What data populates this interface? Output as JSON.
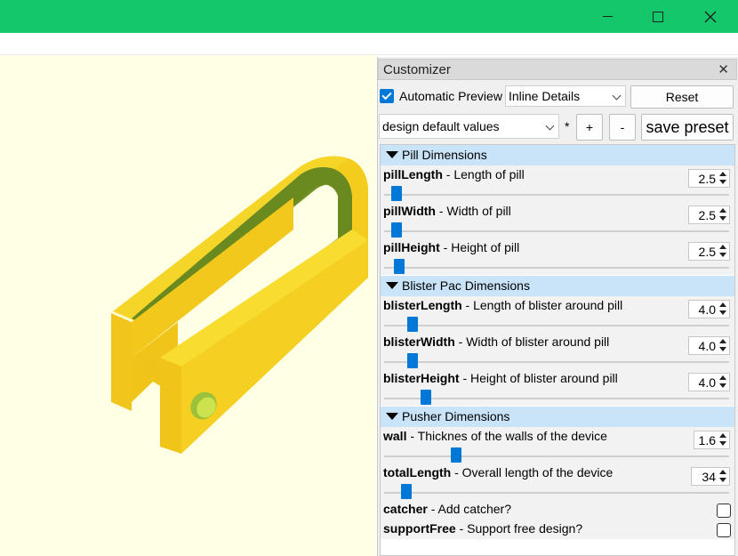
{
  "window": {
    "minimize_icon": "minimize-icon",
    "maximize_icon": "maximize-icon",
    "close_icon": "close-icon",
    "titlebar_color": "#14c76a"
  },
  "viewport": {
    "background": "#ffffe6",
    "model_color": "#f9d52c",
    "inner_color": "#7a9a2a"
  },
  "customizer": {
    "title": "Customizer",
    "close_label": "✕",
    "automatic_preview_label": "Automatic Preview",
    "automatic_preview_checked": true,
    "details_mode": "Inline Details",
    "reset_label": "Reset",
    "preset_value": "design default values",
    "modified_marker": "*",
    "add_preset_label": "+",
    "remove_preset_label": "-",
    "save_preset_label": "save preset",
    "groups": [
      {
        "title": "Pill Dimensions",
        "params": [
          {
            "name": "pillLength",
            "desc": " - Length of pill",
            "value": "2.5",
            "slider": 0.02
          },
          {
            "name": "pillWidth",
            "desc": " - Width of pill",
            "value": "2.5",
            "slider": 0.02
          },
          {
            "name": "pillHeight",
            "desc": " - Height of pill",
            "value": "2.5",
            "slider": 0.03
          }
        ]
      },
      {
        "title": "Blister Pac Dimensions",
        "params": [
          {
            "name": "blisterLength",
            "desc": " - Length of blister around pill",
            "value": "4.0",
            "slider": 0.07
          },
          {
            "name": "blisterWidth",
            "desc": " - Width of blister around pill",
            "value": "4.0",
            "slider": 0.07
          },
          {
            "name": "blisterHeight",
            "desc": " - Height of blister around pill",
            "value": "4.0",
            "slider": 0.11
          }
        ]
      },
      {
        "title": "Pusher Dimensions",
        "params": [
          {
            "name": "wall",
            "desc": " - Thicknes of the walls of the device",
            "value": "1.6",
            "slider": 0.2
          },
          {
            "name": "totalLength",
            "desc": " - Overall length of the device",
            "value": "34",
            "slider": 0.05
          }
        ],
        "checkboxes": [
          {
            "name": "catcher",
            "desc": " - Add catcher?",
            "checked": false
          },
          {
            "name": "supportFree",
            "desc": " - Support free design?",
            "checked": false
          }
        ]
      }
    ]
  }
}
